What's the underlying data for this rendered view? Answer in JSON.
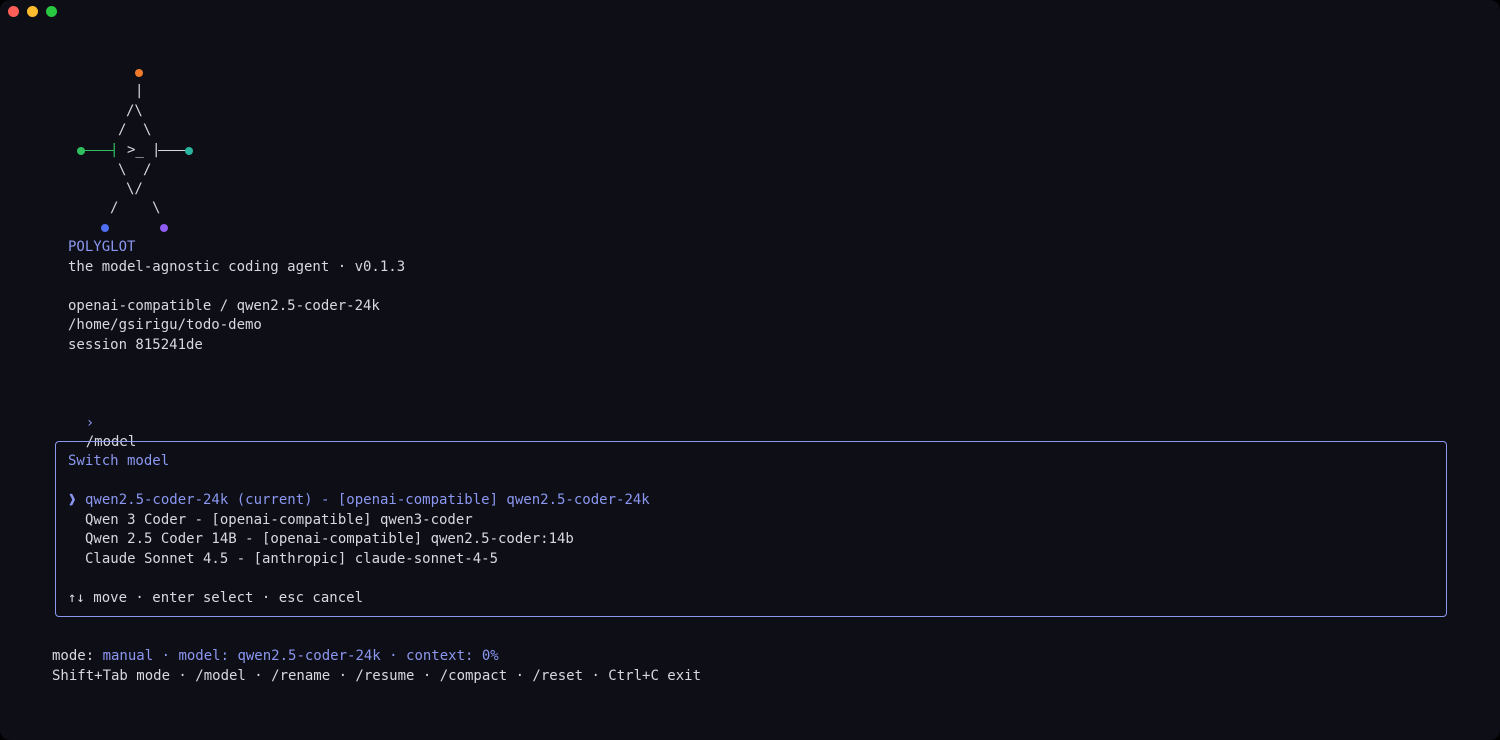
{
  "window": {
    "controls": [
      "close",
      "minimize",
      "zoom"
    ]
  },
  "logo": {
    "glyphs": {
      "stem": "|",
      "peak": "/\\",
      "upper_left": "/",
      "upper_right": "\\",
      "left_bar": "|",
      "prompt": ">_",
      "right_bar": "|",
      "lower_left": "\\",
      "lower_right": "/",
      "valley": "\\/",
      "leg_left": "/",
      "leg_right": "\\"
    },
    "colors": {
      "top_node": "#f07a2a",
      "left_node": "#2fbf5e",
      "right_node": "#2ab5a0",
      "bottom_left_node": "#4f6ef0",
      "bottom_right_node": "#8f5cf0",
      "left_wire": "#2fbf5e",
      "right_wire": "#d7d9e0"
    }
  },
  "header": {
    "app_name": "POLYGLOT",
    "tagline": "the model-agnostic coding agent · v0.1.3",
    "provider_model": "openai-compatible / qwen2.5-coder-24k",
    "cwd": "/home/gsirigu/todo-demo",
    "session": "session 815241de"
  },
  "prompt": {
    "symbol": "›",
    "command": "/model"
  },
  "modal": {
    "title": "Switch model",
    "caret": "❱",
    "items": [
      {
        "label": "qwen2.5-coder-24k (current) - [openai-compatible] qwen2.5-coder-24k",
        "selected": true
      },
      {
        "label": "Qwen 3 Coder - [openai-compatible] qwen3-coder",
        "selected": false
      },
      {
        "label": "Qwen 2.5 Coder 14B - [openai-compatible] qwen2.5-coder:14b",
        "selected": false
      },
      {
        "label": "Claude Sonnet 4.5 - [anthropic] claude-sonnet-4-5",
        "selected": false
      }
    ],
    "help": "↑↓ move · enter select · esc cancel"
  },
  "status": {
    "mode_label": "mode: ",
    "mode_value": "manual",
    "rest": " · model: qwen2.5-coder-24k · context: 0%"
  },
  "shortcuts": "Shift+Tab mode · /model · /rename · /resume · /compact · /reset · Ctrl+C exit",
  "colors": {
    "background": "#0d0e16",
    "text": "#d7d9e0",
    "accent": "#8b97f0",
    "border": "#8b97f0"
  }
}
